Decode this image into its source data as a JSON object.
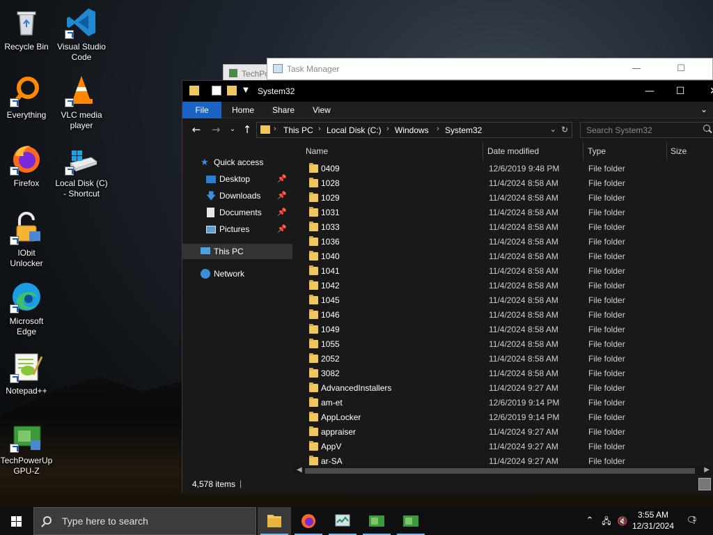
{
  "desktop": {
    "icons": [
      {
        "label": "Recycle Bin",
        "icon": "recycle-bin-icon"
      },
      {
        "label": "Visual Studio Code",
        "icon": "vscode-icon"
      },
      {
        "label": "Everything",
        "icon": "everything-search-icon"
      },
      {
        "label": "VLC media player",
        "icon": "vlc-icon"
      },
      {
        "label": "Firefox",
        "icon": "firefox-icon"
      },
      {
        "label": "Local Disk (C) - Shortcut",
        "icon": "local-disk-icon"
      },
      {
        "label": "IObit Unlocker",
        "icon": "iobit-unlocker-icon"
      },
      {
        "label": "Microsoft Edge",
        "icon": "edge-icon"
      },
      {
        "label": "Notepad++",
        "icon": "notepadpp-icon"
      },
      {
        "label": "TechPowerUp GPU-Z",
        "icon": "gpuz-icon"
      }
    ]
  },
  "background_windows": {
    "task_manager_title": "Task Manager",
    "techpowerup_title": "TechPo"
  },
  "explorer": {
    "title": "System32",
    "ribbon_tabs": [
      "File",
      "Home",
      "Share",
      "View"
    ],
    "breadcrumb": [
      "This PC",
      "Local Disk (C:)",
      "Windows",
      "System32"
    ],
    "search_placeholder": "Search System32",
    "nav": {
      "quick_access": "Quick access",
      "pinned": [
        "Desktop",
        "Downloads",
        "Documents",
        "Pictures"
      ],
      "this_pc": "This PC",
      "network": "Network"
    },
    "columns": [
      "Name",
      "Date modified",
      "Type",
      "Size"
    ],
    "rows": [
      {
        "name": "0409",
        "date": "12/6/2019 9:48 PM",
        "type": "File folder"
      },
      {
        "name": "1028",
        "date": "11/4/2024 8:58 AM",
        "type": "File folder"
      },
      {
        "name": "1029",
        "date": "11/4/2024 8:58 AM",
        "type": "File folder"
      },
      {
        "name": "1031",
        "date": "11/4/2024 8:58 AM",
        "type": "File folder"
      },
      {
        "name": "1033",
        "date": "11/4/2024 8:58 AM",
        "type": "File folder"
      },
      {
        "name": "1036",
        "date": "11/4/2024 8:58 AM",
        "type": "File folder"
      },
      {
        "name": "1040",
        "date": "11/4/2024 8:58 AM",
        "type": "File folder"
      },
      {
        "name": "1041",
        "date": "11/4/2024 8:58 AM",
        "type": "File folder"
      },
      {
        "name": "1042",
        "date": "11/4/2024 8:58 AM",
        "type": "File folder"
      },
      {
        "name": "1045",
        "date": "11/4/2024 8:58 AM",
        "type": "File folder"
      },
      {
        "name": "1046",
        "date": "11/4/2024 8:58 AM",
        "type": "File folder"
      },
      {
        "name": "1049",
        "date": "11/4/2024 8:58 AM",
        "type": "File folder"
      },
      {
        "name": "1055",
        "date": "11/4/2024 8:58 AM",
        "type": "File folder"
      },
      {
        "name": "2052",
        "date": "11/4/2024 8:58 AM",
        "type": "File folder"
      },
      {
        "name": "3082",
        "date": "11/4/2024 8:58 AM",
        "type": "File folder"
      },
      {
        "name": "AdvancedInstallers",
        "date": "11/4/2024 9:27 AM",
        "type": "File folder"
      },
      {
        "name": "am-et",
        "date": "12/6/2019 9:14 PM",
        "type": "File folder"
      },
      {
        "name": "AppLocker",
        "date": "12/6/2019 9:14 PM",
        "type": "File folder"
      },
      {
        "name": "appraiser",
        "date": "11/4/2024 9:27 AM",
        "type": "File folder"
      },
      {
        "name": "AppV",
        "date": "11/4/2024 9:27 AM",
        "type": "File folder"
      },
      {
        "name": "ar-SA",
        "date": "11/4/2024 9:27 AM",
        "type": "File folder"
      }
    ],
    "status": {
      "item_count": "4,578 items"
    }
  },
  "taskbar": {
    "search_placeholder": "Type here to search",
    "apps": [
      "file-explorer-icon",
      "firefox-icon",
      "task-manager-icon",
      "gpuz-icon",
      "gpuz-icon"
    ],
    "clock_time": "3:55 AM",
    "clock_date": "12/31/2024",
    "notification_count": "1"
  }
}
